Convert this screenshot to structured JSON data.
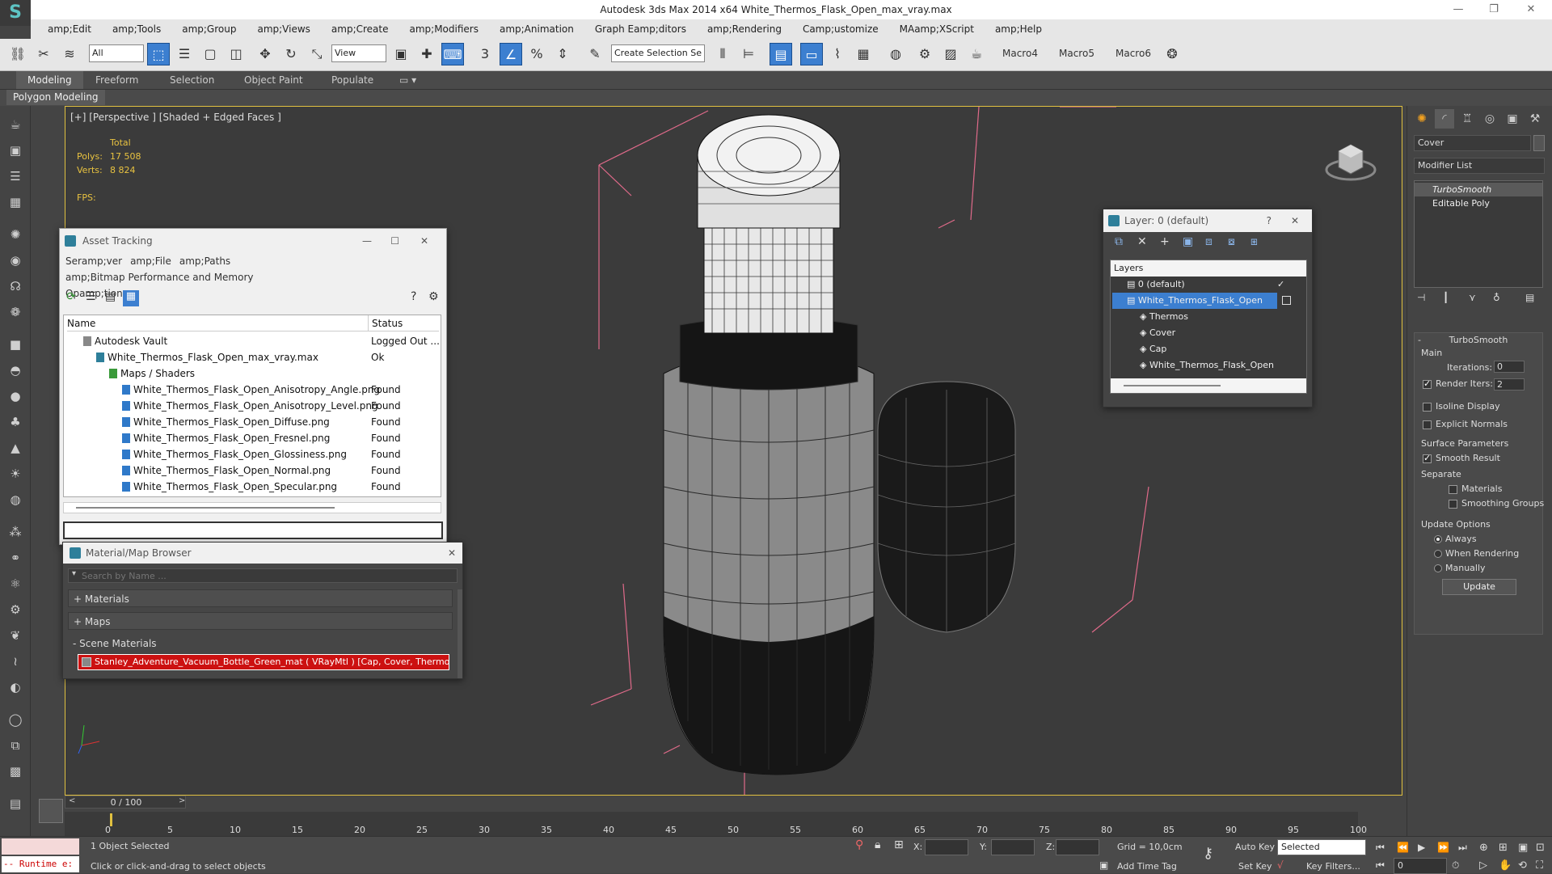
{
  "window": {
    "title": "Autodesk 3ds Max  2014 x64    White_Thermos_Flask_Open_max_vray.max",
    "minimize": "—",
    "maximize": "❐",
    "close": "✕"
  },
  "menu": [
    "amp;Edit",
    "amp;Tools",
    "amp;Group",
    "amp;Views",
    "amp;Create",
    "amp;Modifiers",
    "amp;Animation",
    "Graph Eamp;ditors",
    "amp;Rendering",
    "Camp;ustomize",
    "MAamp;XScript",
    "amp;Help"
  ],
  "toolbar": {
    "filter": "All",
    "refcoord": "View",
    "selection_set": "Create Selection Se",
    "macros": [
      "Macro4",
      "Macro5",
      "Macro6"
    ]
  },
  "ribbon": {
    "tabs": [
      "Modeling",
      "Freeform",
      "Selection",
      "Object Paint",
      "Populate"
    ],
    "active_panel": "Polygon Modeling"
  },
  "viewport": {
    "label": "[+] [Perspective ] [Shaded + Edged Faces ]",
    "stats": {
      "total": "Total",
      "polys_label": "Polys:",
      "polys": "17 508",
      "verts_label": "Verts:",
      "verts": "8 824",
      "fps_label": "FPS:"
    }
  },
  "asset_tracking": {
    "title": "Asset Tracking",
    "menu": [
      "Seramp;ver",
      "amp;File",
      "amp;Paths",
      "amp;Bitmap Performance and Memory",
      "Opamp;tions"
    ],
    "columns": {
      "name": "Name",
      "status": "Status"
    },
    "rows": [
      {
        "name": "Autodesk Vault",
        "status": "Logged Out ..."
      },
      {
        "name": "White_Thermos_Flask_Open_max_vray.max",
        "status": "Ok"
      },
      {
        "name": "Maps / Shaders",
        "status": ""
      },
      {
        "name": "White_Thermos_Flask_Open_Anisotropy_Angle.png",
        "status": "Found"
      },
      {
        "name": "White_Thermos_Flask_Open_Anisotropy_Level.png",
        "status": "Found"
      },
      {
        "name": "White_Thermos_Flask_Open_Diffuse.png",
        "status": "Found"
      },
      {
        "name": "White_Thermos_Flask_Open_Fresnel.png",
        "status": "Found"
      },
      {
        "name": "White_Thermos_Flask_Open_Glossiness.png",
        "status": "Found"
      },
      {
        "name": "White_Thermos_Flask_Open_Normal.png",
        "status": "Found"
      },
      {
        "name": "White_Thermos_Flask_Open_Specular.png",
        "status": "Found"
      }
    ]
  },
  "material_browser": {
    "title": "Material/Map Browser",
    "search_placeholder": "Search by Name ...",
    "sections": {
      "materials": "+ Materials",
      "maps": "+ Maps",
      "scene": "- Scene Materials"
    },
    "scene_material": "Stanley_Adventure_Vacuum_Bottle_Green_mat  ( VRayMtl ) [Cap, Cover, Thermos]"
  },
  "layer_dialog": {
    "title": "Layer: 0 (default)",
    "help": "?",
    "header": "Layers",
    "items": [
      "0 (default)",
      "White_Thermos_Flask_Open",
      "Thermos",
      "Cover",
      "Cap",
      "White_Thermos_Flask_Open"
    ]
  },
  "command_panel": {
    "object_name": "Cover",
    "modifier_list": "Modifier List",
    "stack": [
      "TurboSmooth",
      "Editable Poly"
    ],
    "rollout_title": "TurboSmooth",
    "main": "Main",
    "iterations_label": "Iterations:",
    "iterations": "0",
    "render_iters_label": "Render Iters:",
    "render_iters": "2",
    "isoline": "Isoline Display",
    "explicit_normals": "Explicit Normals",
    "surface_params": "Surface Parameters",
    "smooth_result": "Smooth Result",
    "separate": "Separate",
    "materials": "Materials",
    "smoothing_groups": "Smoothing Groups",
    "update_options": "Update Options",
    "always": "Always",
    "when_rendering": "When Rendering",
    "manually": "Manually",
    "update_btn": "Update"
  },
  "timeline": {
    "frame": "0 / 100",
    "ticks": [
      "0",
      "5",
      "10",
      "15",
      "20",
      "25",
      "30",
      "35",
      "40",
      "45",
      "50",
      "55",
      "60",
      "65",
      "70",
      "75",
      "80",
      "85",
      "90",
      "95",
      "100"
    ]
  },
  "status": {
    "selected": "1 Object Selected",
    "hint": "Click or click-and-drag to select objects",
    "runtime": "-- Runtime e:",
    "x": "X:",
    "y": "Y:",
    "z": "Z:",
    "grid": "Grid = 10,0cm",
    "auto_key": "Auto Key",
    "set_key": "Set Key",
    "key_mode": "Selected",
    "key_filters": "Key Filters...",
    "add_time_tag": "Add Time Tag",
    "frame": "0"
  }
}
